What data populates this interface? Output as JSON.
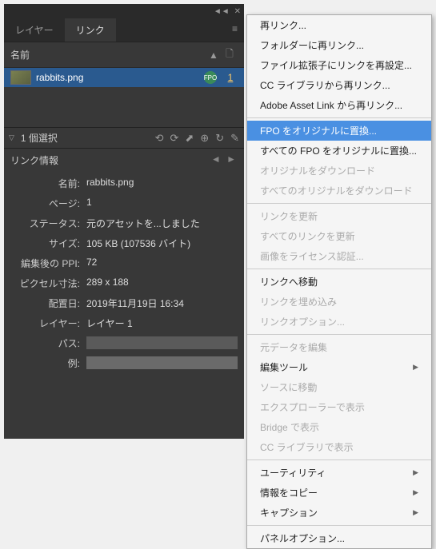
{
  "panel": {
    "tabs": {
      "layers": "レイヤー",
      "links": "リンク"
    },
    "colName": "名前",
    "row": {
      "filename": "rabbits.png",
      "badge": "FPO",
      "page": "1"
    },
    "selection": "1 個選択",
    "infoHeader": "リンク情報",
    "info": {
      "name_l": "名前:",
      "name_v": "rabbits.png",
      "page_l": "ページ:",
      "page_v": "1",
      "status_l": "ステータス:",
      "status_v": "元のアセットを...しました",
      "size_l": "サイズ:",
      "size_v": "105 KB (107536 バイト)",
      "ppi_l": "編集後の PPI:",
      "ppi_v": "72",
      "dim_l": "ピクセル寸法:",
      "dim_v": "289 x 188",
      "date_l": "配置日:",
      "date_v": "2019年11月19日 16:34",
      "layer_l": "レイヤー:",
      "layer_v": "レイヤー 1",
      "path_l": "パス:",
      "ex_l": "例:"
    }
  },
  "menu": {
    "relink": "再リンク...",
    "relinkFolder": "フォルダーに再リンク...",
    "relinkExt": "ファイル拡張子にリンクを再設定...",
    "relinkCC": "CC ライブラリから再リンク...",
    "relinkAAL": "Adobe Asset Link から再リンク...",
    "replaceFPO": "FPO をオリジナルに置換...",
    "replaceAllFPO": "すべての FPO をオリジナルに置換...",
    "dlOrig": "オリジナルをダウンロード",
    "dlAllOrig": "すべてのオリジナルをダウンロード",
    "updateLink": "リンクを更新",
    "updateAll": "すべてのリンクを更新",
    "license": "画像をライセンス認証...",
    "gotoLink": "リンクへ移動",
    "embed": "リンクを埋め込み",
    "linkOpts": "リンクオプション...",
    "editOrig": "元データを編集",
    "editTools": "編集ツール",
    "gotoSrc": "ソースに移動",
    "explorer": "エクスプローラーで表示",
    "bridge": "Bridge で表示",
    "ccLib": "CC ライブラリで表示",
    "utility": "ユーティリティ",
    "copyInfo": "情報をコピー",
    "caption": "キャプション",
    "panelOpts": "パネルオプション..."
  }
}
